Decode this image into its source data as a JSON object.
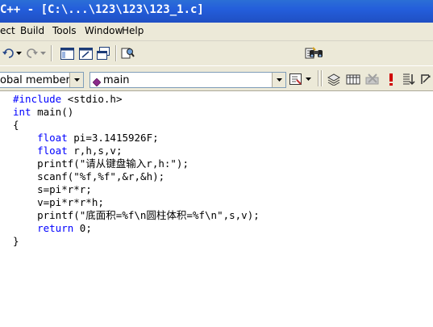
{
  "window": {
    "title": "C++ - [C:\\...\\123\\123\\123_1.c]"
  },
  "menu": {
    "items": [
      "ect",
      "Build",
      "Tools",
      "Window",
      "Help"
    ]
  },
  "toolbar2": {
    "scope_combo": "obal members",
    "function_combo": "main"
  },
  "code": {
    "lines": [
      [
        {
          "t": "#include",
          "k": true
        },
        {
          "t": " <stdio.h>"
        }
      ],
      [
        {
          "t": "int",
          "k": true
        },
        {
          "t": " main()"
        }
      ],
      [
        {
          "t": "{"
        }
      ],
      [
        {
          "t": "    "
        },
        {
          "t": "float",
          "k": true
        },
        {
          "t": " pi=3.1415926F;"
        }
      ],
      [
        {
          "t": "    "
        },
        {
          "t": "float",
          "k": true
        },
        {
          "t": " r,h,s,v;"
        }
      ],
      [
        {
          "t": "    printf(\"请从键盘输入r,h:\");"
        }
      ],
      [
        {
          "t": "    scanf(\"%f,%f\",&r,&h);"
        }
      ],
      [
        {
          "t": "    s=pi*r*r;"
        }
      ],
      [
        {
          "t": "    v=pi*r*r*h;"
        }
      ],
      [
        {
          "t": "    printf(\"底面积=%f\\n圆柱体积=%f\\n\",s,v);"
        }
      ],
      [
        {
          "t": "    "
        },
        {
          "t": "return",
          "k": true
        },
        {
          "t": " 0;"
        }
      ],
      [
        {
          "t": "}"
        }
      ]
    ]
  }
}
